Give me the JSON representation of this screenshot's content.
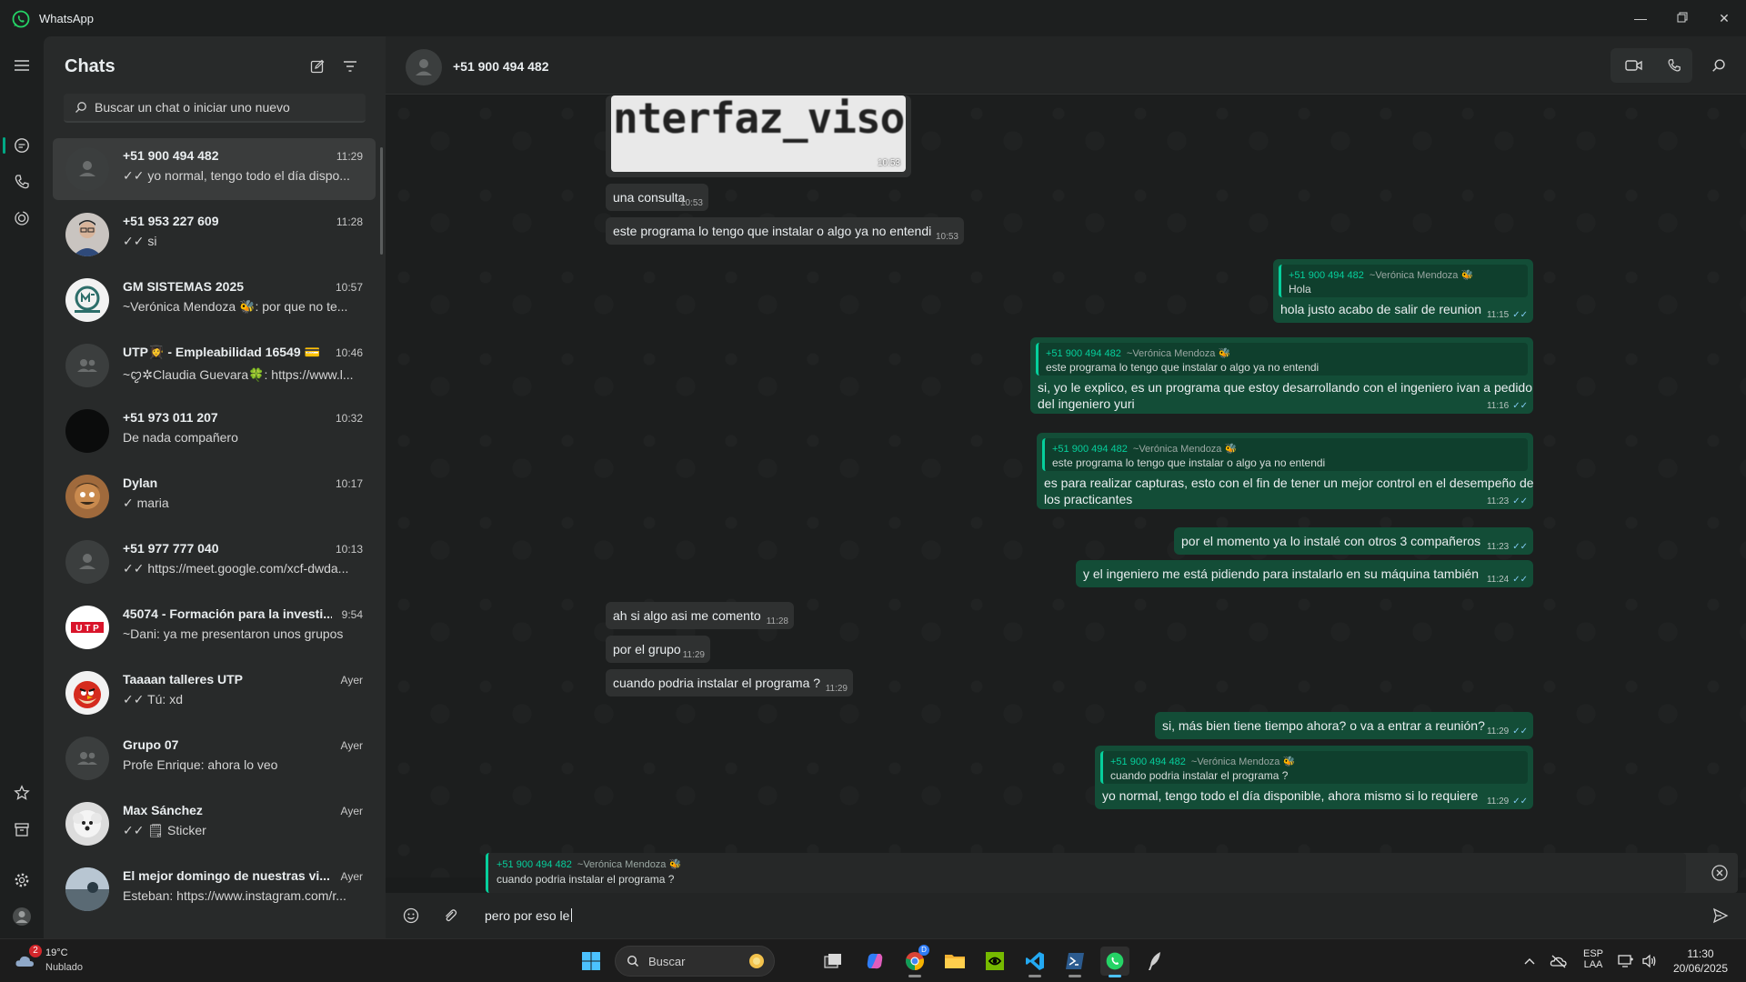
{
  "window": {
    "title": "WhatsApp",
    "accent": "#00a884"
  },
  "chat_list": {
    "title": "Chats",
    "search_placeholder": "Buscar un chat o iniciar uno nuevo",
    "chats": [
      {
        "name": "+51 900 494 482",
        "time": "11:29",
        "preview": "✓✓ yo normal, tengo todo el día dispo...",
        "selected": true
      },
      {
        "name": "+51 953 227 609",
        "time": "11:28",
        "preview": "✓✓ si"
      },
      {
        "name": "GM SISTEMAS 2025",
        "time": "10:57",
        "preview": "~Verónica  Mendoza 🐝: por que no te..."
      },
      {
        "name": "UTP👩‍🎓 - Empleabilidad 16549 💳",
        "time": "10:46",
        "preview": "~ꨄ✲Claudia Guevara🍀: https://www.l..."
      },
      {
        "name": "+51 973 011 207",
        "time": "10:32",
        "preview": "De nada compañero"
      },
      {
        "name": "Dylan",
        "time": "10:17",
        "preview": "✓ maria"
      },
      {
        "name": "+51 977 777 040",
        "time": "10:13",
        "preview": "✓✓ https://meet.google.com/xcf-dwda..."
      },
      {
        "name": "45074 - Formación para la investi...",
        "time": "9:54",
        "preview": "~Dani: ya me presentaron unos grupos"
      },
      {
        "name": "Taaaan talleres UTP",
        "time": "Ayer",
        "preview": "✓✓ Tú: xd"
      },
      {
        "name": "Grupo 07",
        "time": "Ayer",
        "preview": "Profe Enrique: ahora lo veo"
      },
      {
        "name": "Max Sánchez",
        "time": "Ayer",
        "preview": "✓✓ 🗒 Sticker"
      },
      {
        "name": "El mejor domingo de nuestras vi...",
        "time": "Ayer",
        "preview": "Esteban: https://www.instagram.com/r..."
      }
    ]
  },
  "conversation": {
    "contact": "+51 900 494 482",
    "image_text": "nterfaz_visor.",
    "image_time": "10:53",
    "messages": [
      {
        "dir": "in",
        "text": "una consulta",
        "time": "10:53"
      },
      {
        "dir": "in",
        "text": "este programa lo tengo que instalar o algo ya no entendi",
        "time": "10:53"
      },
      {
        "dir": "out",
        "quote_name": "+51 900 494 482",
        "quote_nick": "~Verónica  Mendoza 🐝",
        "quote_text": "Hola",
        "text": "hola justo acabo de salir de reunion",
        "time": "11:15"
      },
      {
        "dir": "out",
        "quote_name": "+51 900 494 482",
        "quote_nick": "~Verónica  Mendoza 🐝",
        "quote_text": "este programa lo tengo que instalar o algo ya no entendi",
        "text": "si, yo le explico, es un programa que estoy desarrollando con el ingeniero ivan a pedido",
        "text2": "del ingeniero yuri",
        "time": "11:16"
      },
      {
        "dir": "out",
        "quote_name": "+51 900 494 482",
        "quote_nick": "~Verónica  Mendoza 🐝",
        "quote_text": "este programa lo tengo que instalar o algo ya no entendi",
        "text": "es para realizar capturas, esto con el fin de tener un mejor control en el desempeño de",
        "text2": "los practicantes",
        "time": "11:23"
      },
      {
        "dir": "out",
        "text": "por el momento ya lo instalé con otros 3 compañeros",
        "time": "11:23"
      },
      {
        "dir": "out",
        "text": "y el ingeniero me está pidiendo para instalarlo en su máquina también",
        "time": "11:24"
      },
      {
        "dir": "in",
        "text": "ah si algo asi me comento",
        "time": "11:28"
      },
      {
        "dir": "in",
        "text": "por el grupo",
        "time": "11:29"
      },
      {
        "dir": "in",
        "text": "cuando podria instalar el programa ?",
        "time": "11:29"
      },
      {
        "dir": "out",
        "text": "si, más bien tiene tiempo ahora? o va a entrar a reunión?",
        "time": "11:29"
      },
      {
        "dir": "out",
        "quote_name": "+51 900 494 482",
        "quote_nick": "~Verónica  Mendoza 🐝",
        "quote_text": "cuando podria instalar el programa ?",
        "text": "yo normal, tengo todo el día disponible, ahora mismo si lo requiere",
        "time": "11:29"
      }
    ]
  },
  "composer": {
    "reply_name": "+51 900 494 482",
    "reply_nick": "~Verónica  Mendoza 🐝",
    "reply_text": "cuando podria instalar el programa ?",
    "draft": "pero por eso le"
  },
  "taskbar": {
    "weather_temp": "19°C",
    "weather_desc": "Nublado",
    "weather_badge": "2",
    "search_label": "Buscar",
    "lang1": "ESP",
    "lang2": "LAA",
    "clock_time": "11:30",
    "clock_date": "20/06/2025"
  }
}
